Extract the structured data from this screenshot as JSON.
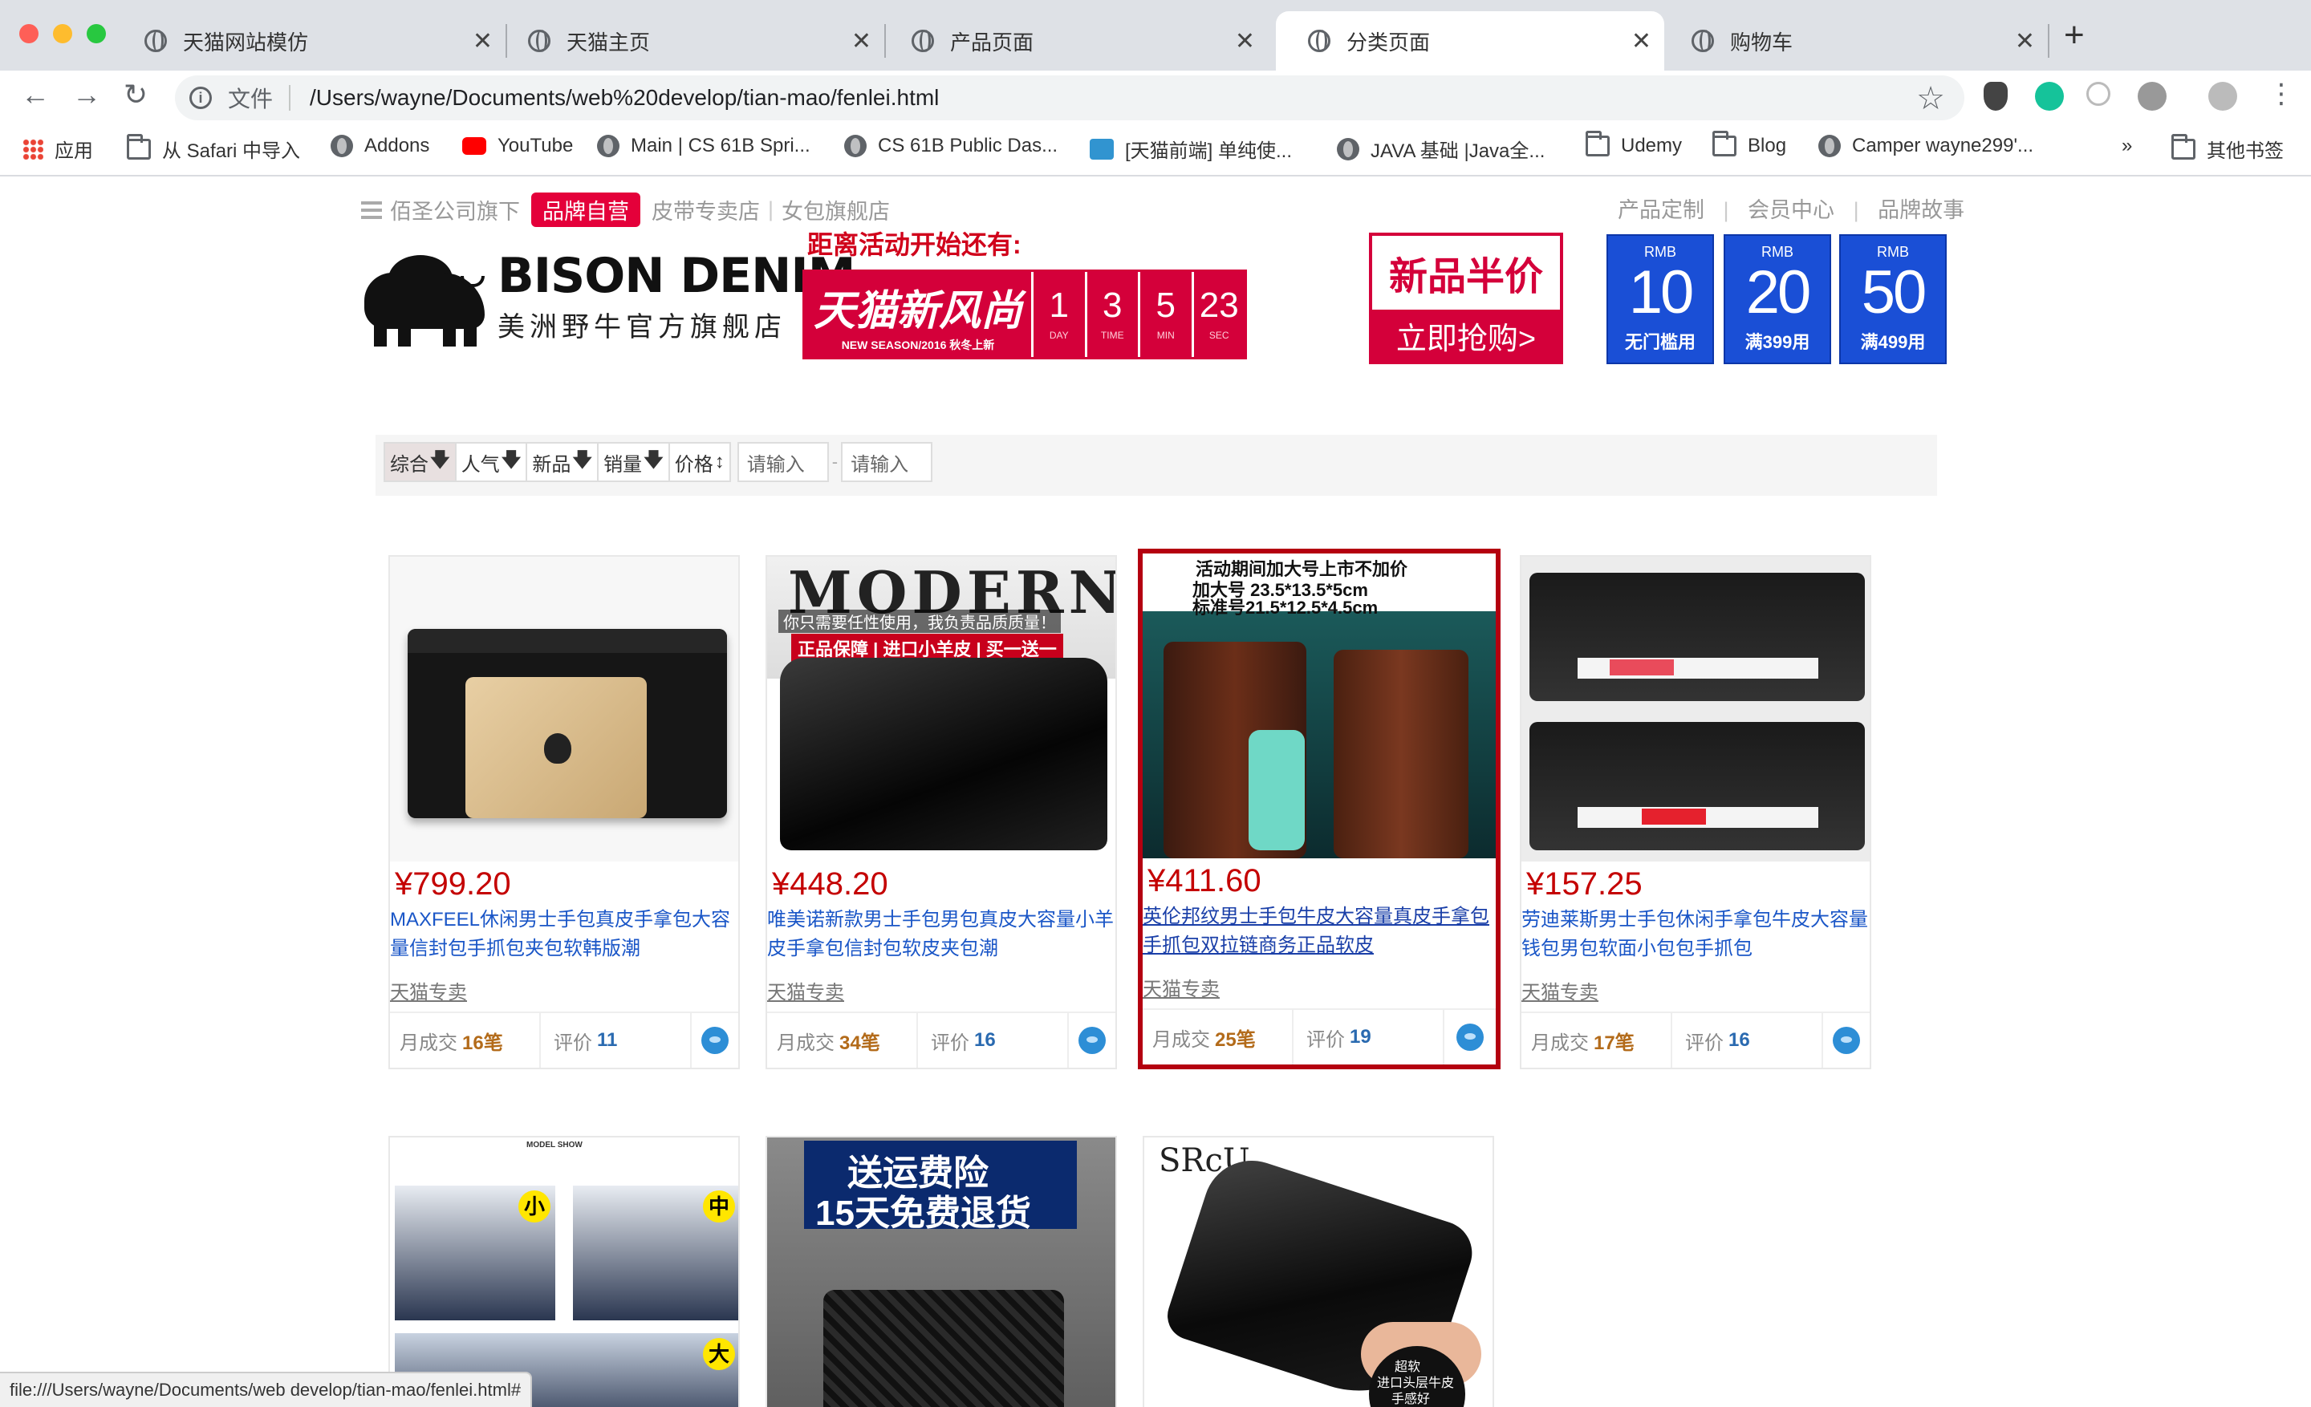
{
  "browser": {
    "tabs": [
      {
        "title": "天猫网站模仿"
      },
      {
        "title": "天猫主页"
      },
      {
        "title": "产品页面"
      },
      {
        "title": "分类页面"
      },
      {
        "title": "购物车"
      }
    ],
    "active_tab_index": 3,
    "address": {
      "scheme_label": "文件",
      "url": "/Users/wayne/Documents/web%20develop/tian-mao/fenlei.html"
    },
    "bookmarks": [
      "应用",
      "从 Safari 中导入",
      "Addons",
      "YouTube",
      "Main | CS 61B Spri...",
      "CS 61B Public Das...",
      "[天猫前端] 单纯使...",
      "JAVA 基础 |Java全...",
      "Udemy",
      "Blog",
      "Camper wayne299'..."
    ],
    "more_bookmarks": "»",
    "other_bookmarks": "其他书签",
    "status_url": "file:///Users/wayne/Documents/web develop/tian-mao/fenlei.html#"
  },
  "header": {
    "left_nav": {
      "prefix": "佰圣公司旗下",
      "badge": "品牌自营",
      "link1": "皮带专卖店",
      "link2": "女包旗舰店"
    },
    "right_nav": [
      "产品定制",
      "会员中心",
      "品牌故事"
    ],
    "logo": {
      "brand": "BISON DENIM",
      "sub": "美洲野牛官方旗舰店"
    },
    "countdown": {
      "heading": "距离活动开始还有:",
      "brand": "天猫新风尚",
      "season": "NEW SEASON/2016 秋冬上新",
      "cells": [
        {
          "num": "1",
          "unit": "DAY"
        },
        {
          "num": "3",
          "unit": "TIME"
        },
        {
          "num": "5",
          "unit": "MIN"
        },
        {
          "num": "23",
          "unit": "SEC"
        }
      ]
    },
    "half_price": {
      "title": "新品半价",
      "cta": "立即抢购>"
    },
    "coupons": [
      {
        "currency": "RMB",
        "amount": "10",
        "cond": "无门槛用"
      },
      {
        "currency": "RMB",
        "amount": "20",
        "cond": "满399用"
      },
      {
        "currency": "RMB",
        "amount": "50",
        "cond": "满499用"
      }
    ]
  },
  "filter": {
    "sorts": [
      {
        "label": "综合",
        "arrow": "🡇"
      },
      {
        "label": "人气",
        "arrow": "🡇"
      },
      {
        "label": "新品",
        "arrow": "🡇"
      },
      {
        "label": "销量",
        "arrow": "🡇"
      },
      {
        "label": "价格",
        "arrow": "↕"
      }
    ],
    "min_placeholder": "请输入",
    "max_placeholder": "请输入",
    "dash": "-"
  },
  "products": [
    {
      "price": "¥799.20",
      "title": "MAXFEEL休闲男士手包真皮手拿包大容量信封包手抓包夹包软韩版潮",
      "shop": "天猫专卖",
      "monthly_label": "月成交",
      "monthly": "16笔",
      "review_label": "评价",
      "reviews": "11"
    },
    {
      "price": "¥448.20",
      "title": "唯美诺新款男士手包男包真皮大容量小羊皮手拿包信封包软皮夹包潮",
      "shop": "天猫专卖",
      "monthly_label": "月成交",
      "monthly": "34笔",
      "review_label": "评价",
      "reviews": "16"
    },
    {
      "price": "¥411.60",
      "title": "英伦邦纹男士手包牛皮大容量真皮手拿包手抓包双拉链商务正品软皮",
      "shop": "天猫专卖",
      "monthly_label": "月成交",
      "monthly": "25笔",
      "review_label": "评价",
      "reviews": "19",
      "img_text": [
        "活动期间加大号上市不加价",
        "加大号 23.5*13.5*5cm",
        "标准号21.5*12.5*4.5cm"
      ]
    },
    {
      "price": "¥157.25",
      "title": "劳迪莱斯男士手包休闲手拿包牛皮大容量钱包男包软面小包包手抓包",
      "shop": "天猫专卖",
      "monthly_label": "月成交",
      "monthly": "17笔",
      "review_label": "评价",
      "reviews": "16"
    },
    {
      "img_text": [
        "MODEL SHOW",
        "小",
        "中",
        "大"
      ]
    },
    {
      "img_text": [
        "送运费险",
        "15天免费退货"
      ]
    },
    {
      "img_text": [
        "SRcU",
        "超软",
        "进口头层牛皮",
        "手感好"
      ]
    }
  ],
  "img2_text": {
    "big": "MODERN",
    "line1": "你只需要任性使用，我负责品质质量！",
    "line2": "正品保障 | 进口小羊皮 | 买一送一"
  },
  "colors": {
    "tmall_red": "#d4003a",
    "price_red": "#c40000",
    "link_blue": "#1a56c7",
    "coupon_blue": "#1a4fd6"
  }
}
